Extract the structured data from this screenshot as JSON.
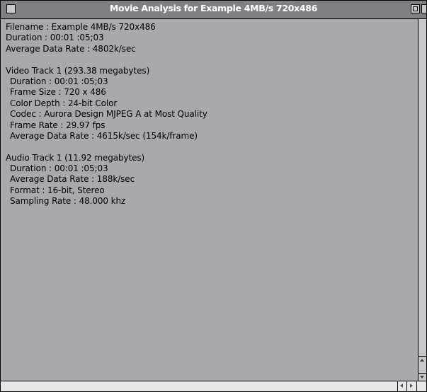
{
  "window": {
    "title": "Movie Analysis for Example 4MB/s 720x486"
  },
  "summary": {
    "filename": "Filename : Example 4MB/s 720x486",
    "duration": "Duration : 00:01 :05;03",
    "data_rate": "Average Data Rate : 4802k/sec"
  },
  "video_track": {
    "header": "Video Track 1 (293.38 megabytes)",
    "duration": "Duration : 00:01 :05;03",
    "frame_size": "Frame Size : 720 x 486",
    "color_depth": "Color Depth : 24-bit Color",
    "codec": "Codec : Aurora Design MJPEG A at Most Quality",
    "frame_rate": "Frame Rate : 29.97 fps",
    "data_rate": "Average Data Rate : 4615k/sec (154k/frame)"
  },
  "audio_track": {
    "header": "Audio Track 1 (11.92 megabytes)",
    "duration": "Duration : 00:01 :05;03",
    "data_rate": "Average Data Rate : 188k/sec",
    "format": "Format : 16-bit, Stereo",
    "sampling_rate": "Sampling Rate : 48.000 khz"
  },
  "colors": {
    "content_background": "#a9a9ad",
    "title_bar": "#7f7f86",
    "title_text": "#ffffff"
  }
}
